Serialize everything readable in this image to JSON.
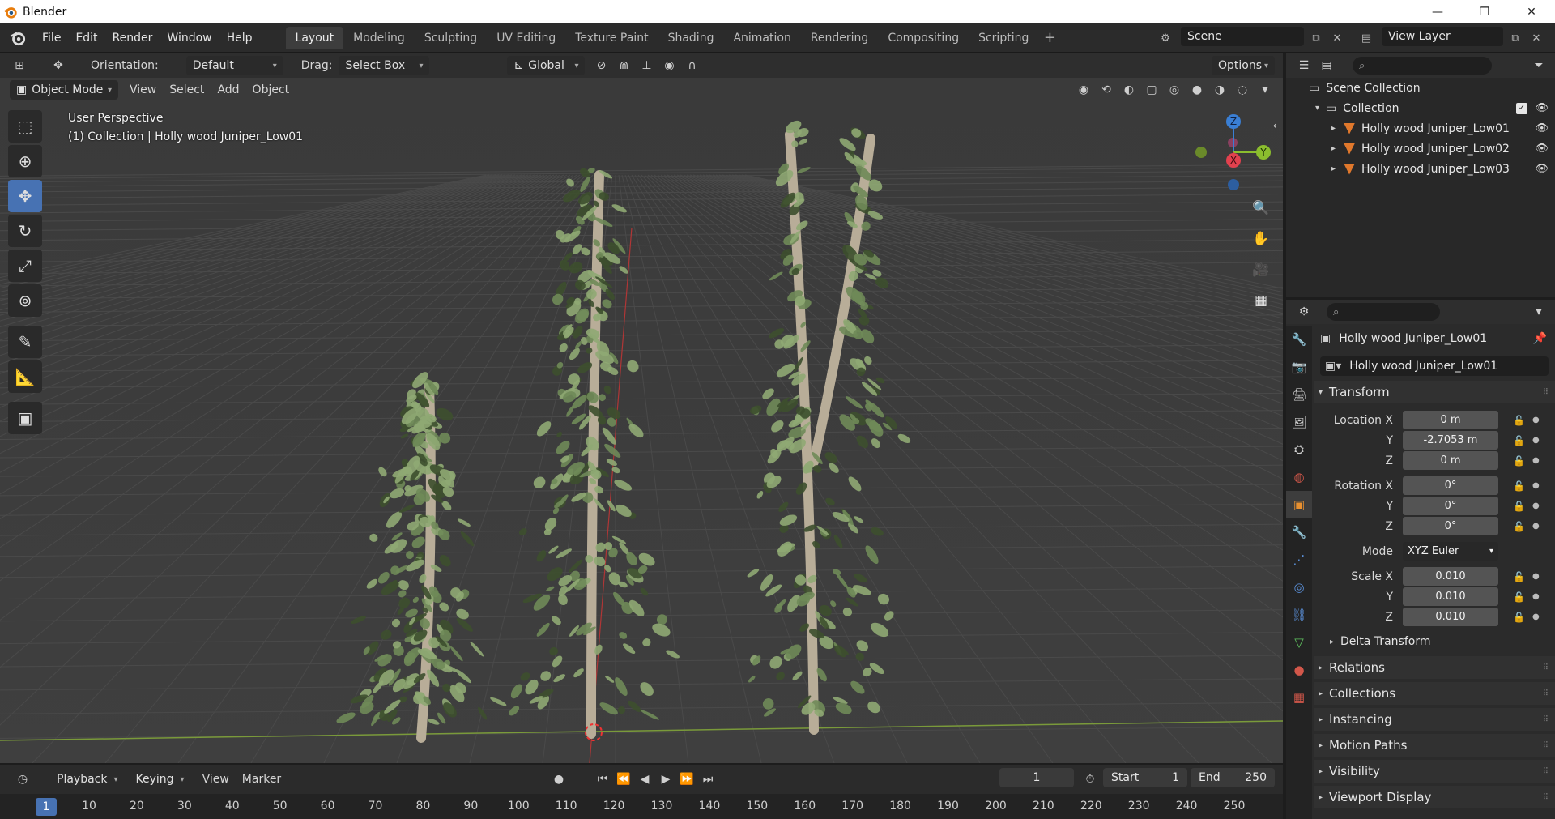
{
  "window": {
    "title": "Blender",
    "minimize": "—",
    "maximize": "❐",
    "close": "✕"
  },
  "menu": {
    "items": [
      "File",
      "Edit",
      "Render",
      "Window",
      "Help"
    ]
  },
  "workspaces": {
    "tabs": [
      "Layout",
      "Modeling",
      "Sculpting",
      "UV Editing",
      "Texture Paint",
      "Shading",
      "Animation",
      "Rendering",
      "Compositing",
      "Scripting"
    ],
    "active": "Layout",
    "add": "+"
  },
  "scene": {
    "label": "Scene",
    "view_layer": "View Layer"
  },
  "tool_header": {
    "orientation_label": "Orientation:",
    "orientation_value": "Default",
    "drag_label": "Drag:",
    "drag_value": "Select Box",
    "transform_orientation": "Global",
    "options": "Options"
  },
  "viewport_header": {
    "mode": "Object Mode",
    "menus": [
      "View",
      "Select",
      "Add",
      "Object"
    ]
  },
  "viewport": {
    "perspective": "User Perspective",
    "collection_info": "(1) Collection | Holly wood Juniper_Low01",
    "gizmo": {
      "z": "Z",
      "y": "Y",
      "x": "X"
    }
  },
  "timeline": {
    "menus": [
      "Playback",
      "Keying",
      "View",
      "Marker"
    ],
    "current_frame": "1",
    "start_label": "Start",
    "start_value": "1",
    "end_label": "End",
    "end_value": "250",
    "ticks": [
      "1",
      "10",
      "20",
      "30",
      "40",
      "50",
      "60",
      "70",
      "80",
      "90",
      "100",
      "110",
      "120",
      "130",
      "140",
      "150",
      "160",
      "170",
      "180",
      "190",
      "200",
      "210",
      "220",
      "230",
      "240",
      "250"
    ]
  },
  "outliner": {
    "scene_collection": "Scene Collection",
    "collection": "Collection",
    "objects": [
      "Holly wood Juniper_Low01",
      "Holly wood Juniper_Low02",
      "Holly wood Juniper_Low03"
    ]
  },
  "properties": {
    "object_title": "Holly wood Juniper_Low01",
    "object_name": "Holly wood Juniper_Low01",
    "transform_label": "Transform",
    "location": {
      "label_x": "Location X",
      "label_y": "Y",
      "label_z": "Z",
      "x": "0 m",
      "y": "-2.7053 m",
      "z": "0 m"
    },
    "rotation": {
      "label_x": "Rotation X",
      "label_y": "Y",
      "label_z": "Z",
      "x": "0°",
      "y": "0°",
      "z": "0°"
    },
    "mode": {
      "label": "Mode",
      "value": "XYZ Euler"
    },
    "scale": {
      "label_x": "Scale X",
      "label_y": "Y",
      "label_z": "Z",
      "x": "0.010",
      "y": "0.010",
      "z": "0.010"
    },
    "delta_transform": "Delta Transform",
    "panels": [
      "Relations",
      "Collections",
      "Instancing",
      "Motion Paths",
      "Visibility",
      "Viewport Display"
    ]
  },
  "colors": {
    "accent": "#4772b3",
    "tree_foliage": "#8fa873",
    "tree_trunk": "#b8ad98",
    "x_axis": "#e2414e",
    "y_axis": "#8bbd2e",
    "z_axis": "#3a7fd4"
  }
}
